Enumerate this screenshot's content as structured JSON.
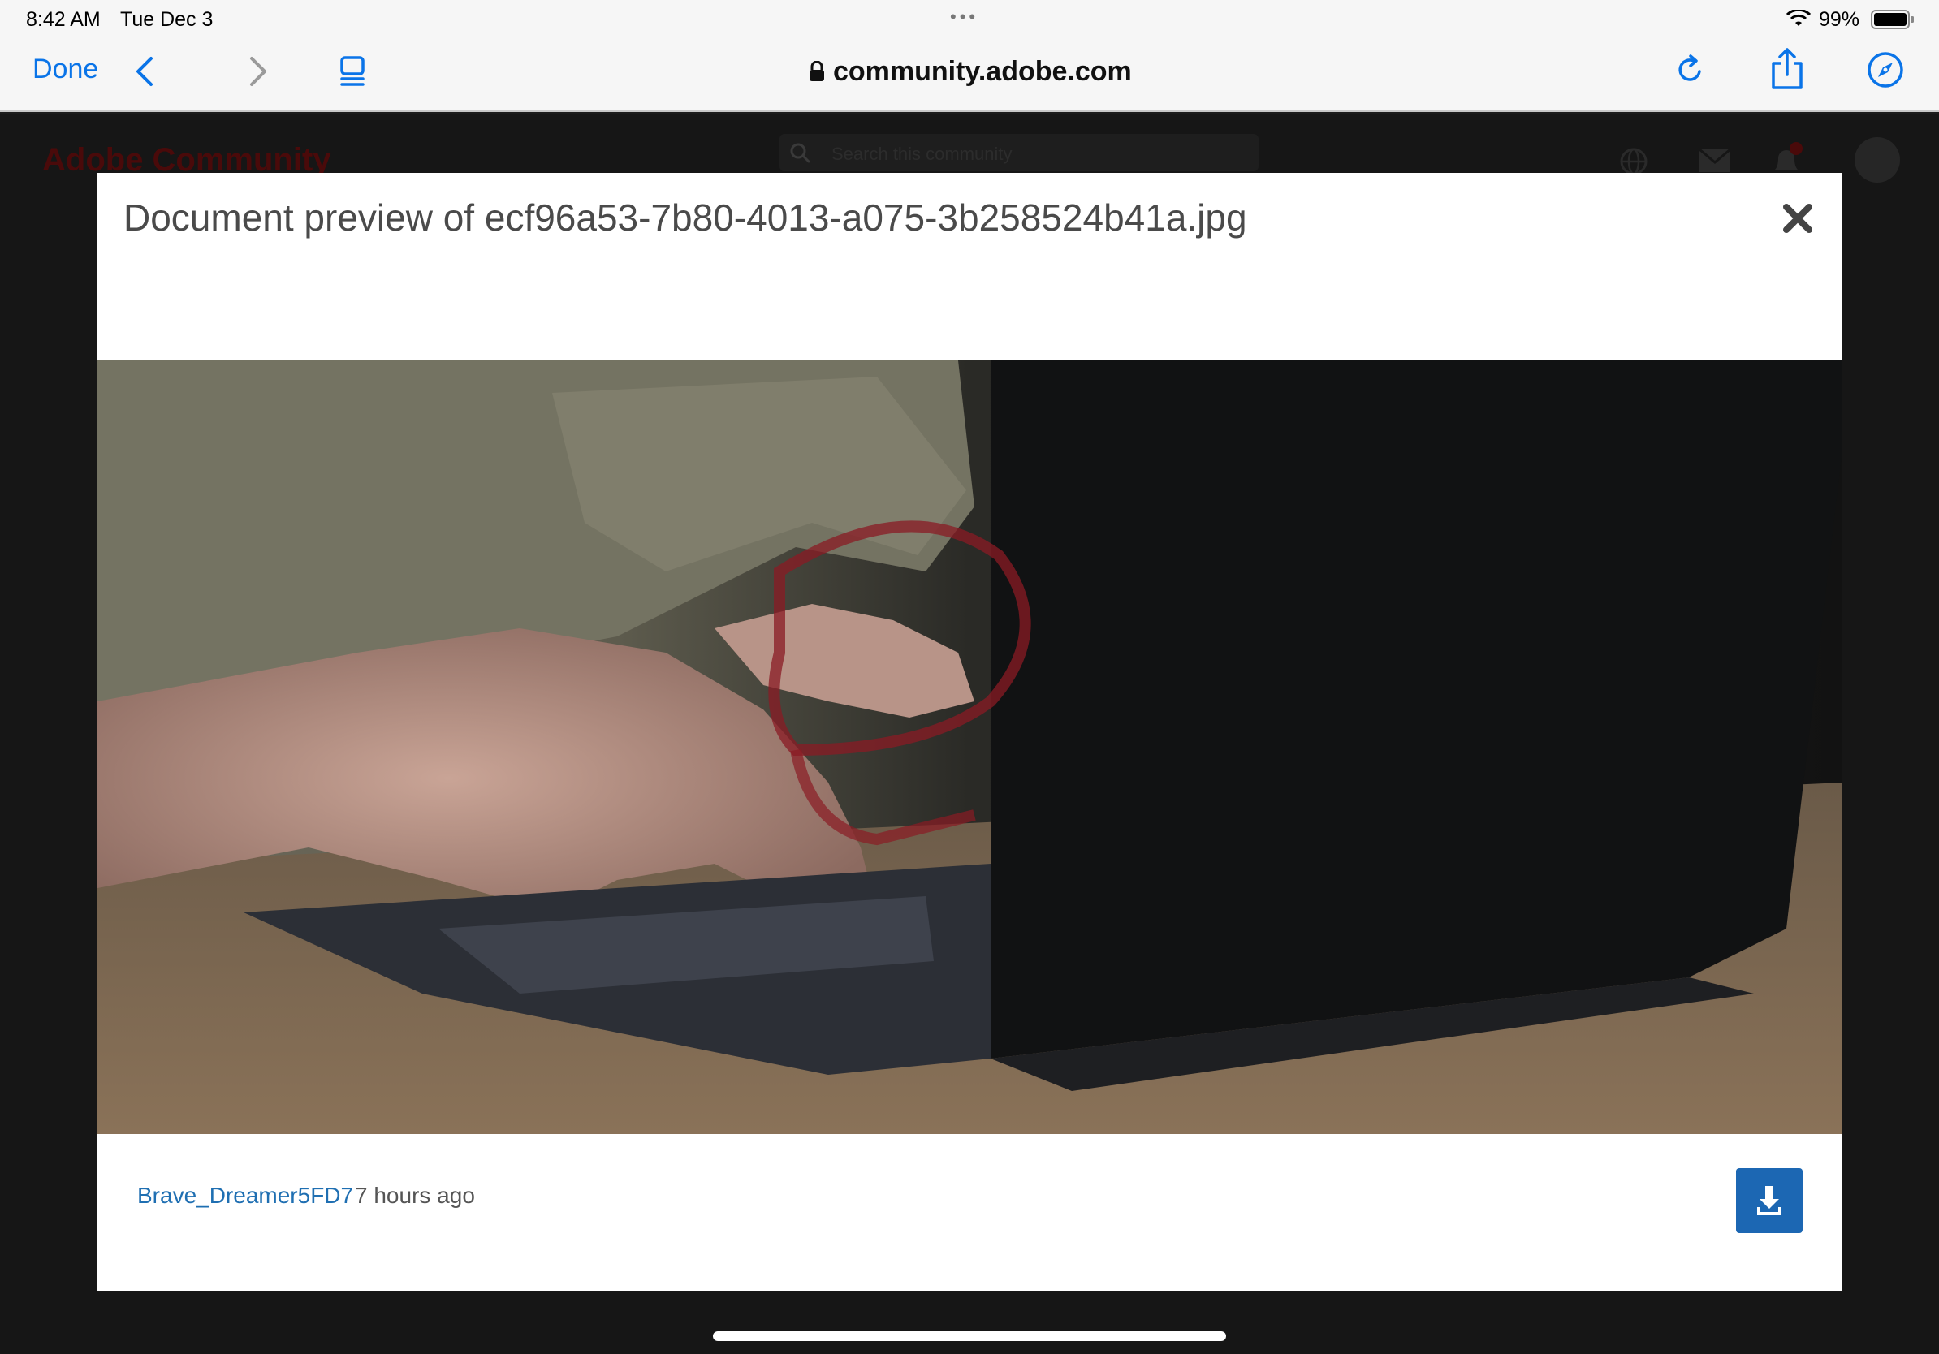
{
  "status_bar": {
    "time": "8:42 AM",
    "date": "Tue Dec 3",
    "battery": "99%"
  },
  "toolbar": {
    "done_label": "Done",
    "url": "community.adobe.com",
    "icons": [
      "back-icon",
      "forward-icon",
      "tabs-icon",
      "lock-icon",
      "reload-icon",
      "share-icon",
      "compass-icon"
    ]
  },
  "background_page": {
    "logo": "Adobe Community",
    "search_placeholder": "Search this community"
  },
  "modal": {
    "title": "Document preview of ecf96a53-7b80-4013-a075-3b258524b41a.jpg",
    "author": "Brave_Dreamer5FD7",
    "time_ago": "7 hours ago"
  },
  "colors": {
    "accent": "#0a74e8",
    "link": "#1f6fb2",
    "download_button": "#1c67b3",
    "overlay": "#161616"
  }
}
